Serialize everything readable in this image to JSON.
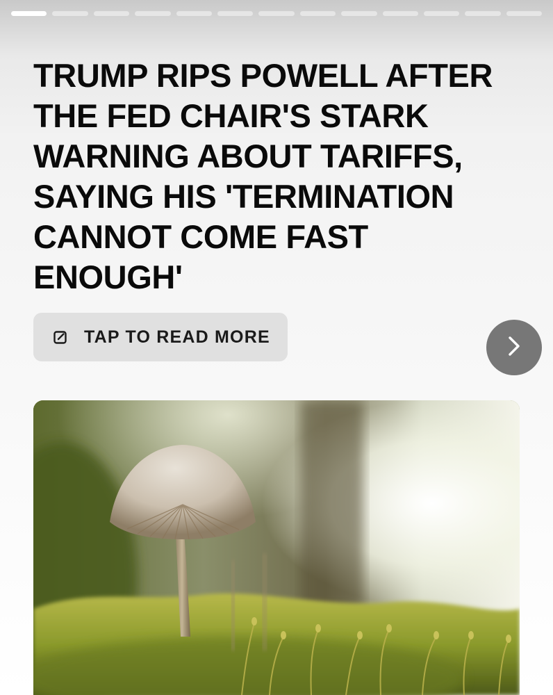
{
  "story": {
    "progress": {
      "segments": 13,
      "active_index": 0
    },
    "headline": "TRUMP RIPS POWELL AFTER THE FED CHAIR'S STARK WARNING ABOUT TARIFFS, SAYING HIS 'TERMINATION CANNOT COME FAST ENOUGH'",
    "read_more": {
      "label": "TAP TO READ MORE",
      "icon": "external-link-icon"
    },
    "next_button": {
      "icon": "chevron-right-icon"
    },
    "image": {
      "subject": "mushroom-photo"
    }
  },
  "colors": {
    "button_bg": "#e0e0e0",
    "next_bg": "#777777",
    "text": "#0a0a0a"
  }
}
